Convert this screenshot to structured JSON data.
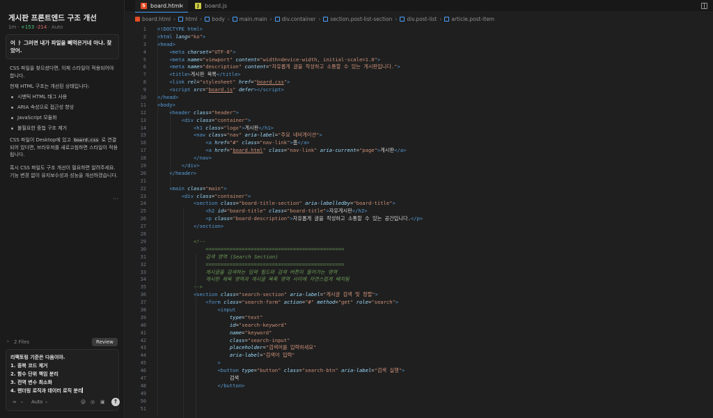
{
  "chat": {
    "title": "게시판 프론트엔드 구조 개선",
    "meta_time": "1m",
    "meta_added": "+153",
    "meta_removed": "-214",
    "meta_mode": "Auto",
    "user_message": "어 ㅏ 그러면 내가 파일을 빼먹은거네 아냐. 찾았어.",
    "reply_p1": "CSS 파일을 찾으셨다면, 이제 스타일이 적용되어야 합니다.",
    "reply_p2": "현재 HTML 구조는 개선된 상태입니다:",
    "reply_bullets": [
      "시맨틱 HTML 태그 사용",
      "ARIA 속성으로 접근성 향상",
      "JavaScript 모듈화",
      "불필요한 중첩 구조 제거"
    ],
    "reply_p3_before": "CSS 파일이 Desktop에 있고 ",
    "reply_p3_code": "board.css",
    "reply_p3_after": " 로 연결되어 있다면, 브라우저를 새로고침하면 스타일이 적용됩니다.",
    "reply_p4": "혹시 CSS 파일도 구조 개선이 필요하면 알려주세요. 기능 변경 없이 유지보수성과 성능을 개선하겠습니다.",
    "more": "···",
    "files_label": "2 Files",
    "review_label": "Review",
    "composer_text": "리팩토링 기준은 다음이야.\n1. 중복 코드 제거\n2. 함수 단위 책임 분리\n3. 전역 변수 최소화\n4. 렌더링 로직과 데이터 로직 분리",
    "mode_icon": "∞",
    "model_label": "Auto"
  },
  "tabs": [
    {
      "label": "board.html",
      "icon": "html-file-icon",
      "active": true
    },
    {
      "label": "board.js",
      "icon": "js-file-icon",
      "active": false
    }
  ],
  "breadcrumb": [
    "board.html",
    "html",
    "body",
    "main.main",
    "div.container",
    "section.post-list-section",
    "div.post-list",
    "article.post-item"
  ],
  "line_numbers": [
    "1",
    "2",
    "3",
    "4",
    "5",
    "6",
    "7",
    "8",
    "9",
    "10",
    "11",
    "12",
    "13",
    "14",
    "15",
    "16",
    "17",
    "18",
    "19",
    "20",
    "21",
    "22",
    "23",
    "24",
    "25",
    "26",
    "27",
    "28",
    "29",
    "30",
    "31",
    "32",
    "33",
    "34",
    "35",
    "36",
    "37",
    "38",
    "39",
    "40",
    "41",
    "42",
    "43",
    "44",
    "45",
    "46",
    "47",
    "48",
    "49",
    "50",
    "51"
  ],
  "code": {
    "l1": "<!DOCTYPE html>",
    "l2_lang": "\"ko\"",
    "l4_cs": "\"UTF-8\"",
    "l5_name": "\"viewport\"",
    "l5_content": "\"width=device-width, initial-scale=1.0\"",
    "l6_name": "\"description\"",
    "l6_content": "\"자유롭게 글을 작성하고 소통할 수 있는 게시판입니다.\"",
    "l7_text": "게시판 목록",
    "l8_rel": "\"stylesheet\"",
    "l8_href": "board.css",
    "l9_src": "board.js",
    "l12_class": "\"header\"",
    "l13_class": "\"container\"",
    "l14_class": "\"logo\"",
    "l14_text": "게시판",
    "l15_class": "\"nav\"",
    "l15_aria": "\"주요 네비게이션\"",
    "l16_href": "\"#\"",
    "l16_class": "\"nav-link\"",
    "l16_text": "홈",
    "l17_href": "board.html",
    "l17_class": "\"nav-link\"",
    "l17_aria": "\"page\"",
    "l17_text": "게시판",
    "l22_class": "\"main\"",
    "l23_class": "\"container\"",
    "l24_class": "\"board-title-section\"",
    "l24_aria": "\"board-title\"",
    "l25_id": "\"board-title\"",
    "l25_class": "\"board-title\"",
    "l25_text": "자유게시판",
    "l26_class": "\"board-description\"",
    "l26_text": "자유롭게 글을 작성하고 소통할 수 있는 공간입니다.",
    "l29": "<!--",
    "l30": "==============================================",
    "l31": "검색 영역 (Search Section)",
    "l32": "==============================================",
    "l33": "게시글을 검색하는 입력 필드와 검색 버튼이 들어가는 영역",
    "l34": "게시판 제목 영역과 게시글 목록 영역 사이에 자연스럽게 배치됨",
    "l35": "-->",
    "l36_class": "\"search-section\"",
    "l36_aria": "\"게시글 검색 및 정렬\"",
    "l37_class": "\"search-form\"",
    "l37_action": "\"#\"",
    "l37_method": "\"get\"",
    "l37_role": "\"search\"",
    "l39_type": "\"text\"",
    "l40_id": "\"search-keyword\"",
    "l41_name": "\"keyword\"",
    "l42_class": "\"search-input\"",
    "l43_ph": "\"검색어를 입력하세요\"",
    "l44_aria": "\"검색어 입력\"",
    "l46_type": "\"button\"",
    "l46_class": "\"search-btn\"",
    "l46_aria": "\"검색 실행\"",
    "l47_text": "검색"
  }
}
